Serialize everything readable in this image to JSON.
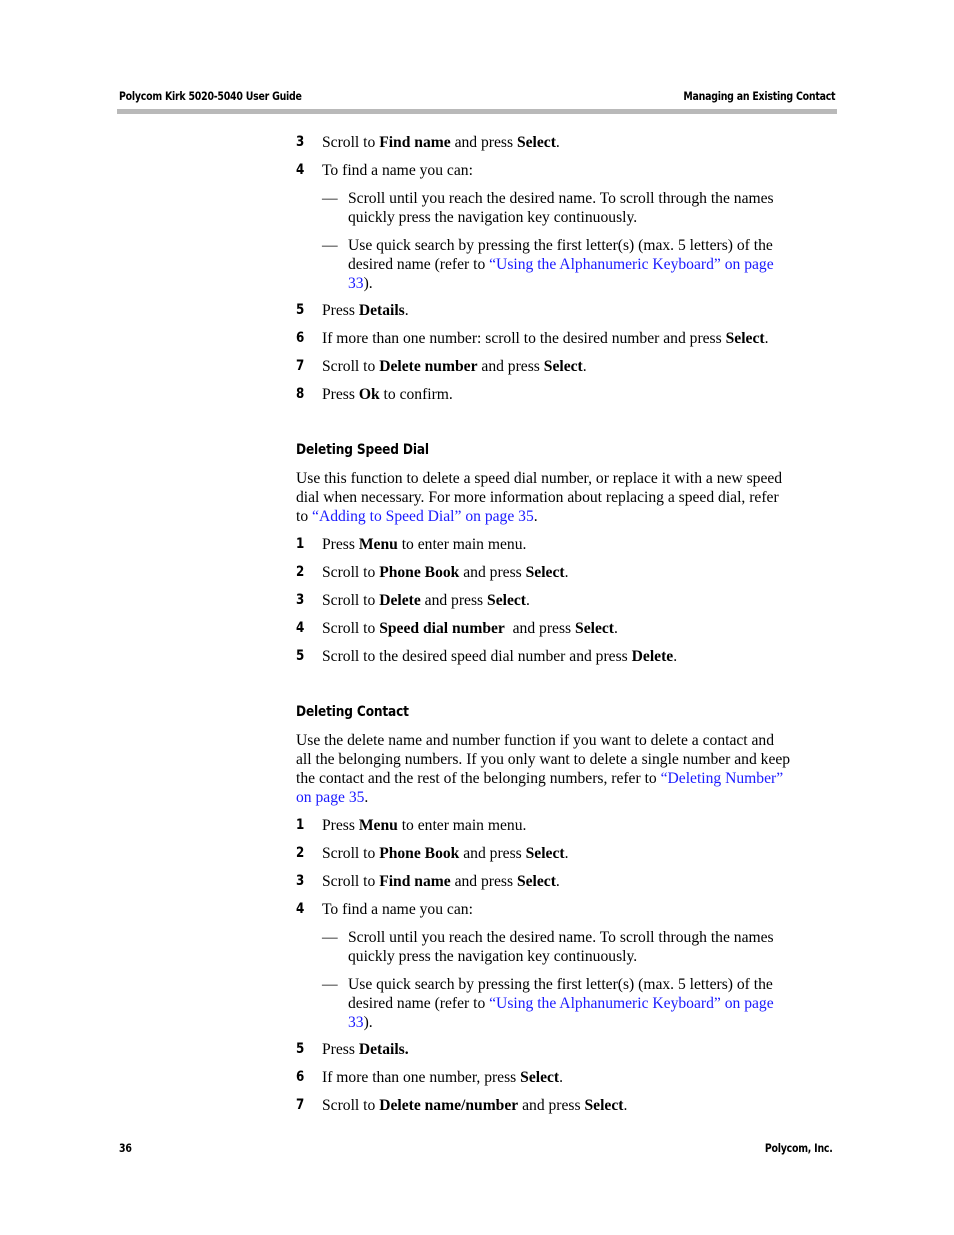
{
  "header": {
    "title": "Polycom Kirk 5020-5040 User Guide",
    "section": "Managing an Existing Contact"
  },
  "footer": {
    "page_number": "36",
    "company": "Polycom, Inc."
  },
  "colors": {
    "link": "#1a1aff",
    "rule": "#b9b9b9"
  },
  "top_steps": [
    {
      "num": "3",
      "pre": "Scroll to ",
      "b1": "Find name",
      "mid": " and press ",
      "b2": "Select",
      "post": "."
    },
    {
      "num": "4",
      "text": "To find a name you can:"
    },
    {
      "num": "5",
      "pre": "Press ",
      "b1": "Details",
      "post": "."
    },
    {
      "num": "6",
      "pre": "If more than one number: scroll to the desired number and press ",
      "b1": "Select",
      "post": "."
    },
    {
      "num": "7",
      "pre": "Scroll to ",
      "b1": "Delete number",
      "mid": " and press ",
      "b2": "Select",
      "post": "."
    },
    {
      "num": "8",
      "pre": "Press ",
      "b1": "Ok",
      "post": " to confirm."
    }
  ],
  "find_bullets": {
    "dash": "—",
    "b1_line1": "Scroll until you reach the desired name. To scroll through the names",
    "b1_line2": "quickly press the navigation key continuously.",
    "b2_line1": "Use quick search by pressing the first letter(s) (max. 5 letters) of the",
    "b2_line2_pre": "desired name (refer to ",
    "b2_link_part1": "“Using the Alphanumeric Keyboard” on page",
    "b2_link_part2": "33",
    "b2_post": ")."
  },
  "speed_dial": {
    "heading": "Deleting Speed Dial",
    "intro_line1": "Use this function to delete a speed dial number, or replace it with a new speed",
    "intro_line2": "dial when necessary. For more information about replacing a speed dial, refer",
    "intro_line3_pre": "to ",
    "intro_link": "“Adding to Speed Dial” on page 35",
    "intro_post": ".",
    "steps": [
      {
        "num": "1",
        "pre": "Press ",
        "b1": "Menu",
        "post": " to enter main menu."
      },
      {
        "num": "2",
        "pre": "Scroll to ",
        "b1": "Phone Book",
        "mid": " and press ",
        "b2": "Select",
        "post": "."
      },
      {
        "num": "3",
        "pre": "Scroll to ",
        "b1": "Delete",
        "mid": " and press ",
        "b2": "Select",
        "post": "."
      },
      {
        "num": "4",
        "pre": "Scroll to ",
        "b1": "Speed dial number",
        "mid": "  and press ",
        "b2": "Select",
        "post": "."
      },
      {
        "num": "5",
        "pre": "Scroll to the desired speed dial number and press ",
        "b1": "Delete",
        "post": "."
      }
    ]
  },
  "contact": {
    "heading": "Deleting Contact",
    "intro_line1": "Use the delete name and number function if you want to delete a contact and",
    "intro_line2": "all the belonging numbers. If you only want to delete a single number and keep",
    "intro_line3_pre": "the contact and the rest of the belonging numbers, refer to ",
    "intro_link_part1": "“Deleting Number”",
    "intro_link_part2": "on page 35",
    "intro_post": ".",
    "steps": [
      {
        "num": "1",
        "pre": "Press ",
        "b1": "Menu",
        "post": " to enter main menu."
      },
      {
        "num": "2",
        "pre": "Scroll to ",
        "b1": "Phone Book",
        "mid": " and press ",
        "b2": "Select",
        "post": "."
      },
      {
        "num": "3",
        "pre": "Scroll to ",
        "b1": "Find name",
        "mid": " and press ",
        "b2": "Select",
        "post": "."
      },
      {
        "num": "4",
        "text": "To find a name you can:"
      },
      {
        "num": "5",
        "pre": "Press ",
        "b1": "Details.",
        "post": ""
      },
      {
        "num": "6",
        "pre": "If more than one number, press ",
        "b1": "Select",
        "post": "."
      },
      {
        "num": "7",
        "pre": "Scroll to ",
        "b1": "Delete name/number",
        "mid": " and press ",
        "b2": "Select",
        "post": "."
      }
    ]
  }
}
